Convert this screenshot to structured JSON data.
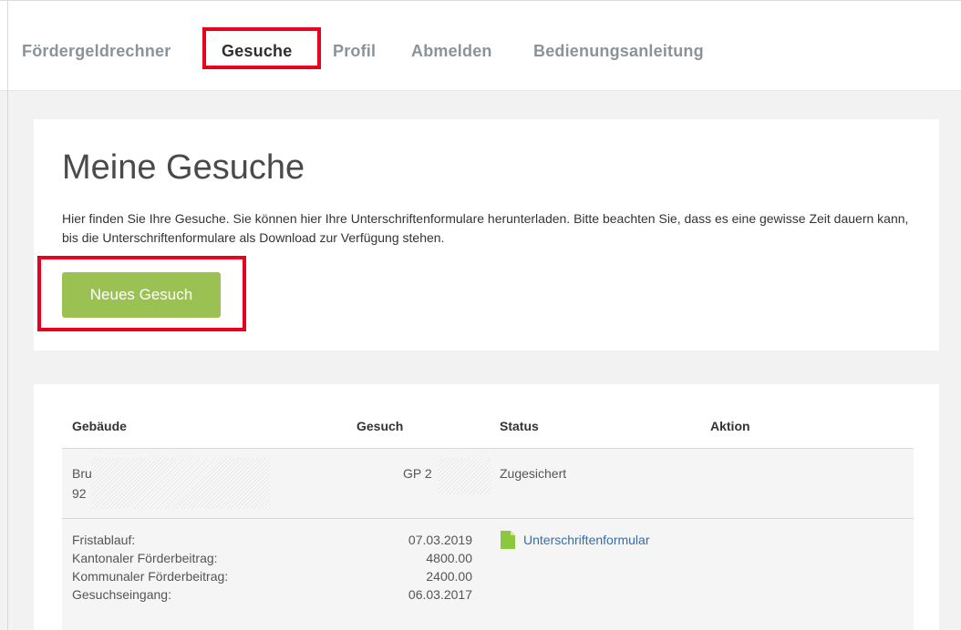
{
  "nav": {
    "items": [
      "Fördergeldrechner",
      "Gesuche",
      "Profil",
      "Abmelden",
      "Bedienungsanleitung"
    ],
    "active_index": 1
  },
  "header": {
    "title": "Meine Gesuche",
    "intro": "Hier finden Sie Ihre Gesuche. Sie können hier Ihre Unterschriftenformulare herunterladen. Bitte beachten Sie, dass es eine gewisse Zeit dauern kann, bis die Unterschriftenformulare als Download zur Verfügung stehen.",
    "new_button": "Neues Gesuch"
  },
  "table": {
    "headers": {
      "building": "Gebäude",
      "request": "Gesuch",
      "status": "Status",
      "action": "Aktion"
    },
    "row": {
      "building_line1": "Bru",
      "building_line2": "92",
      "request": "GP 2",
      "status": "Zugesichert"
    },
    "details": {
      "labels": [
        "Fristablauf:",
        "Kantonaler Förderbeitrag:",
        "Kommunaler Förderbeitrag:",
        "Gesuchseingang:"
      ],
      "values": [
        "07.03.2019",
        "4800.00",
        "2400.00",
        "06.03.2017"
      ],
      "download_link": "Unterschriftenformular"
    }
  },
  "colors": {
    "accent_green": "#9bc153",
    "highlight_red": "#e8001c",
    "link_blue": "#2f6fb0",
    "icon_green": "#8dc63f"
  }
}
